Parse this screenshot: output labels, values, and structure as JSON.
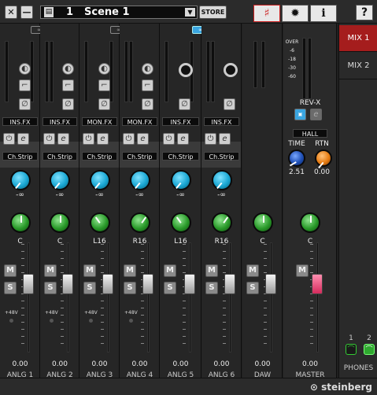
{
  "topbar": {
    "scene_number": "1",
    "scene_name": "Scene 1",
    "store_label": "STORE",
    "info_label": "i",
    "help_label": "?",
    "min_label": "—",
    "close_label": "✕",
    "doc_glyph": "▤",
    "dropdown_glyph": "▼"
  },
  "mix_tabs": [
    {
      "label": "MIX 1",
      "active": true
    },
    {
      "label": "MIX 2",
      "active": false
    }
  ],
  "channels": [
    {
      "name": "ANLG 1",
      "ins": "INS.FX",
      "strip": "Ch.Strip",
      "send": "-∞",
      "pan": "C",
      "vol": "0.00",
      "phantom": "+48V",
      "mono": false
    },
    {
      "name": "ANLG 2",
      "ins": "INS.FX",
      "strip": "Ch.Strip",
      "send": "-∞",
      "pan": "C",
      "vol": "0.00",
      "phantom": "+48V",
      "mono": false
    },
    {
      "name": "ANLG 3",
      "ins": "MON.FX",
      "strip": "Ch.Strip",
      "send": "-∞",
      "pan": "L16",
      "vol": "0.00",
      "phantom": "+48V",
      "mono": false
    },
    {
      "name": "ANLG 4",
      "ins": "MON.FX",
      "strip": "Ch.Strip",
      "send": "-∞",
      "pan": "R16",
      "vol": "0.00",
      "phantom": "+48V",
      "mono": false
    },
    {
      "name": "ANLG 5",
      "ins": "INS.FX",
      "strip": "Ch.Strip",
      "send": "-∞",
      "pan": "L16",
      "vol": "0.00",
      "phantom": "",
      "mono": true
    },
    {
      "name": "ANLG 6",
      "ins": "INS.FX",
      "strip": "Ch.Strip",
      "send": "-∞",
      "pan": "R16",
      "vol": "0.00",
      "phantom": "",
      "mono": true
    }
  ],
  "daw": {
    "name": "DAW",
    "pan": "C",
    "vol": "0.00"
  },
  "master": {
    "name": "MASTER",
    "pan": "C",
    "vol": "0.00",
    "reverb": "REV-X",
    "reverb_type": "HALL",
    "time_label": "TIME",
    "rtn_label": "RTN",
    "time_val": "2.51",
    "rtn_val": "0.00",
    "meter_labels": [
      "OVER",
      "-6",
      "-18",
      "-30",
      "-60"
    ]
  },
  "phones": {
    "label": "PHONES",
    "out1": "1",
    "out2": "2"
  },
  "brand": "steinberg",
  "icons": {
    "link": "link-icon",
    "power": "power-icon",
    "edit": "edit-icon",
    "mute": "M",
    "solo": "S",
    "mix_setting": "mixer-sliders-icon",
    "gear": "gear-icon"
  }
}
